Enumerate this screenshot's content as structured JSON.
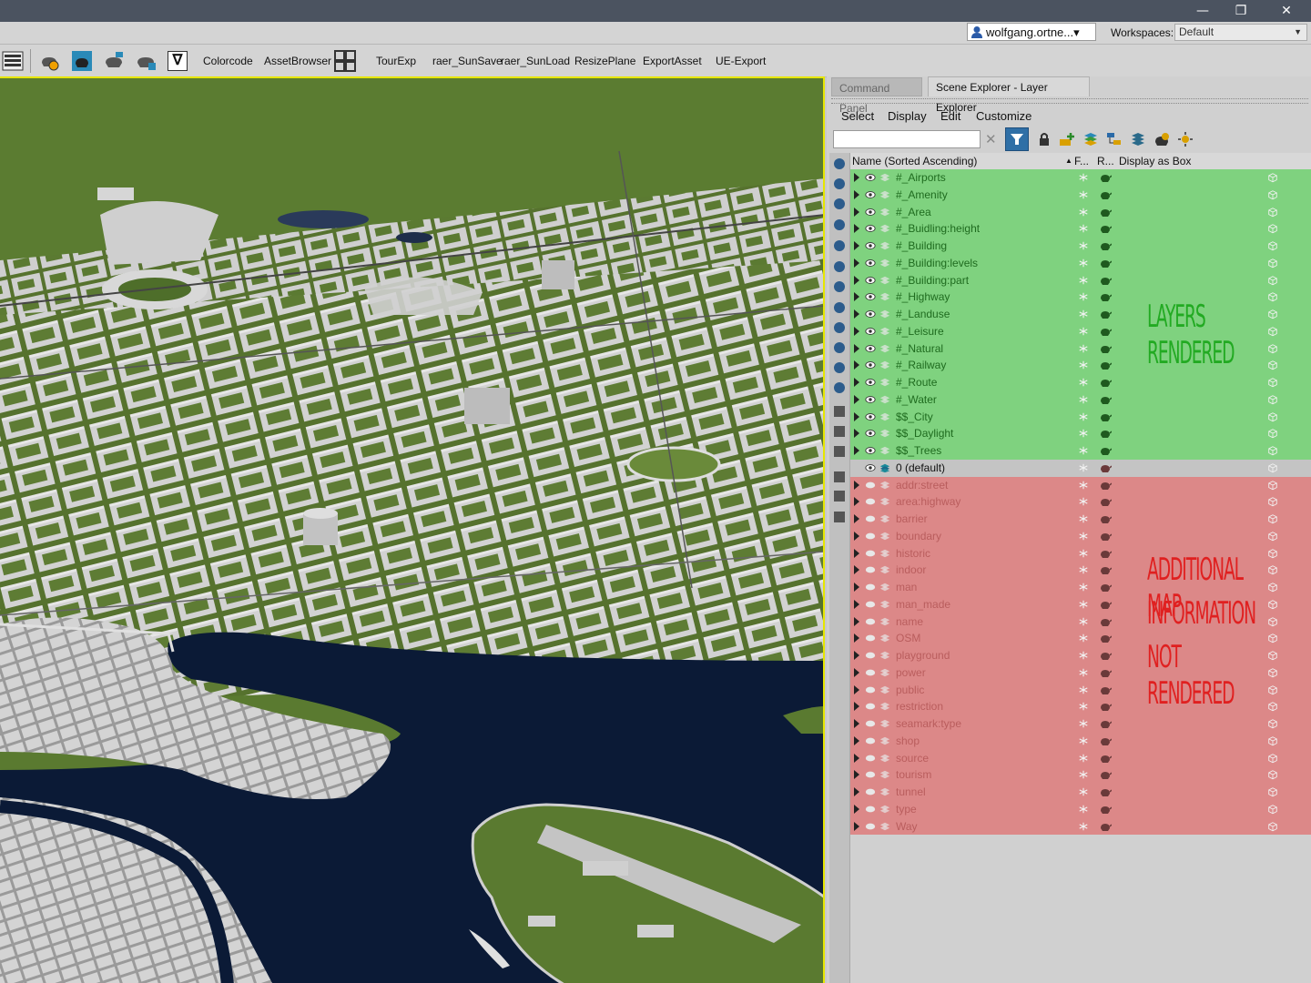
{
  "window": {
    "minimize_glyph": "—",
    "restore_glyph": "❐",
    "close_glyph": "✕"
  },
  "userbar": {
    "user": "wolfgang.ortne...▾",
    "workspaces_label": "Workspaces:",
    "workspace_value": "Default",
    "dropdown_glyph": "▼"
  },
  "toolbar": {
    "icons": [
      "render-setup-icon",
      "render-frame-icon",
      "render-teapot-icon",
      "render-active-icon",
      "viewport-toggle-icon"
    ],
    "items": [
      "Colorcode",
      "AssetBrowser",
      "TourExp",
      "raer_SunSave",
      "raer_SunLoad",
      "ResizePlane",
      "ExportAsset",
      "UE-Export"
    ],
    "filter_glyph": "∇"
  },
  "panel": {
    "tabs": [
      "Command Panel",
      "Scene Explorer - Layer Explorer"
    ],
    "menu": [
      "Select",
      "Display",
      "Edit",
      "Customize"
    ],
    "clear_glyph": "✕",
    "columns": {
      "name": "Name (Sorted Ascending)",
      "sort_glyph": "▲",
      "frozen": "F...",
      "renderable": "R...",
      "display_as_box": "Display as Box"
    },
    "annotations": {
      "rendered": "LAYERS RENDERED",
      "not_rendered": [
        "ADDITIONAL MAP",
        "INFORMATION",
        "NOT RENDERED"
      ]
    }
  },
  "layers_rendered": [
    "#_Airports",
    "#_Amenity",
    "#_Area",
    "#_Buidling:height",
    "#_Building",
    "#_Building:levels",
    "#_Building:part",
    "#_Highway",
    "#_Landuse",
    "#_Leisure",
    "#_Natural",
    "#_Railway",
    "#_Route",
    "#_Water",
    "$$_City",
    "$$_Daylight",
    "$$_Trees"
  ],
  "layer_default": "0 (default)",
  "layers_not_rendered": [
    "addr:street",
    "area:highway",
    "barrier",
    "boundary",
    "historic",
    "indoor",
    "man",
    "man_made",
    "name",
    "OSM",
    "playground",
    "power",
    "public",
    "restriction",
    "seamark:type",
    "shop",
    "source",
    "tourism",
    "tunnel",
    "type",
    "Way"
  ],
  "colors": {
    "rendered_bg": "#7fd27f",
    "not_rendered_bg": "#dc8888",
    "annotation_green": "#22aa22",
    "annotation_red": "#e02020",
    "viewport_border": "#e6e600",
    "water": "#0b1a36",
    "grass": "#5a7a30",
    "buildings": "#c8c8c8"
  }
}
